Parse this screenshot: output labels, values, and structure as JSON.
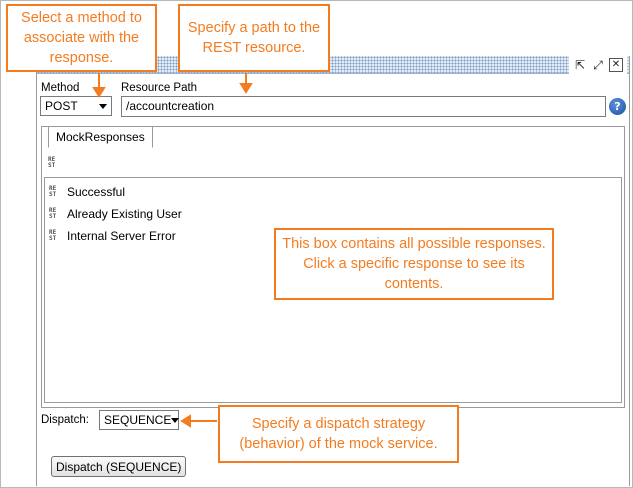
{
  "editor": {
    "method_label": "Method",
    "method_value": "POST",
    "resource_path_label": "Resource Path",
    "resource_path_value": "/accountcreation",
    "help_glyph": "?",
    "tab_label": "MockResponses",
    "responses": [
      {
        "label": "Successful"
      },
      {
        "label": "Already Existing User"
      },
      {
        "label": "Internal Server Error"
      }
    ],
    "dispatch_label": "Dispatch:",
    "dispatch_value": "SEQUENCE",
    "dispatch_button": "Dispatch (SEQUENCE)"
  },
  "annotations": {
    "method_note": "Select a method to associate with the response.",
    "path_note": "Specify a path to the REST resource.",
    "list_note": "This box contains all possible responses. Click a specific response to see its contents.",
    "dispatch_note": "Specify a dispatch strategy (behavior) of the mock service."
  },
  "colors": {
    "annotation": "#f47c20"
  }
}
